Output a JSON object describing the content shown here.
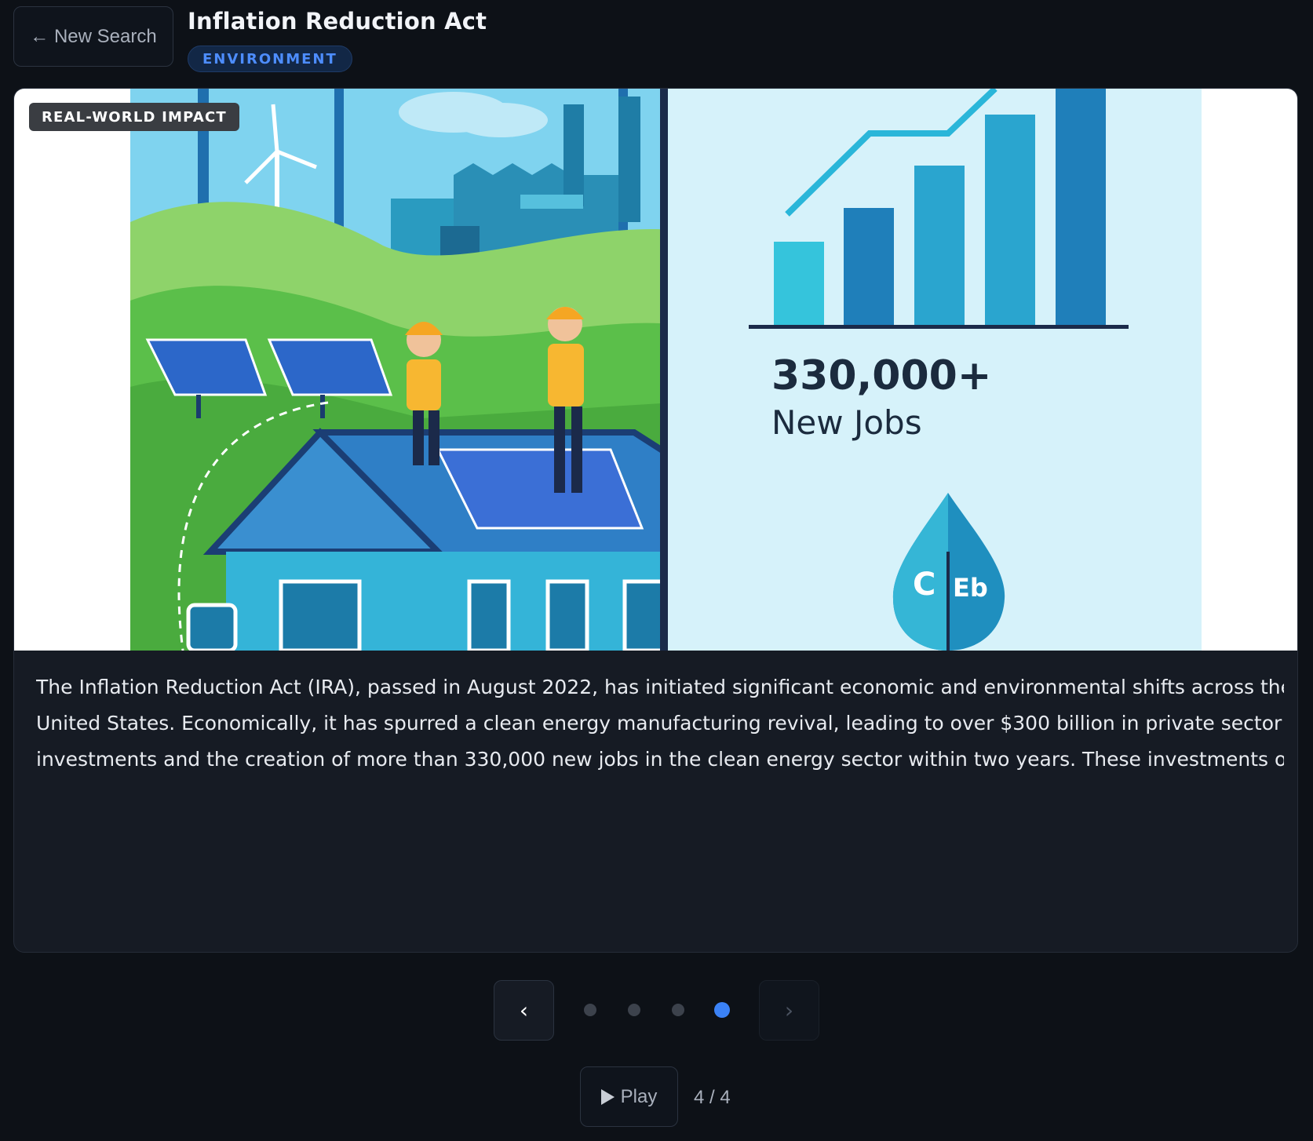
{
  "header": {
    "back_label": "← New Search",
    "title": "Inflation Reduction Act",
    "category": "ENVIRONMENT"
  },
  "slide": {
    "badge": "REAL-WORLD IMPACT",
    "illustration": {
      "stat_value": "330,000+",
      "stat_label": "New Jobs",
      "leaf_text_left": "C",
      "leaf_text_right": "Eb"
    },
    "text_lines": [
      "The Inflation Reduction Act (IRA), passed in August 2022, has initiated significant economic and environmental shifts across the",
      "United States. Economically, it has spurred a clean energy manufacturing revival, leading to over $300 billion in private sector",
      "investments and the creation of more than 330,000 new jobs in the clean energy sector within two years. These investments ofte"
    ]
  },
  "navigation": {
    "prev_label": "‹",
    "next_label": "›",
    "dots": 4,
    "active_dot": 4,
    "play_label": "Play",
    "counter": "4 / 4"
  },
  "colors": {
    "background": "#0d1117",
    "accent": "#3b82f6",
    "badge_text": "#4d8dff"
  }
}
